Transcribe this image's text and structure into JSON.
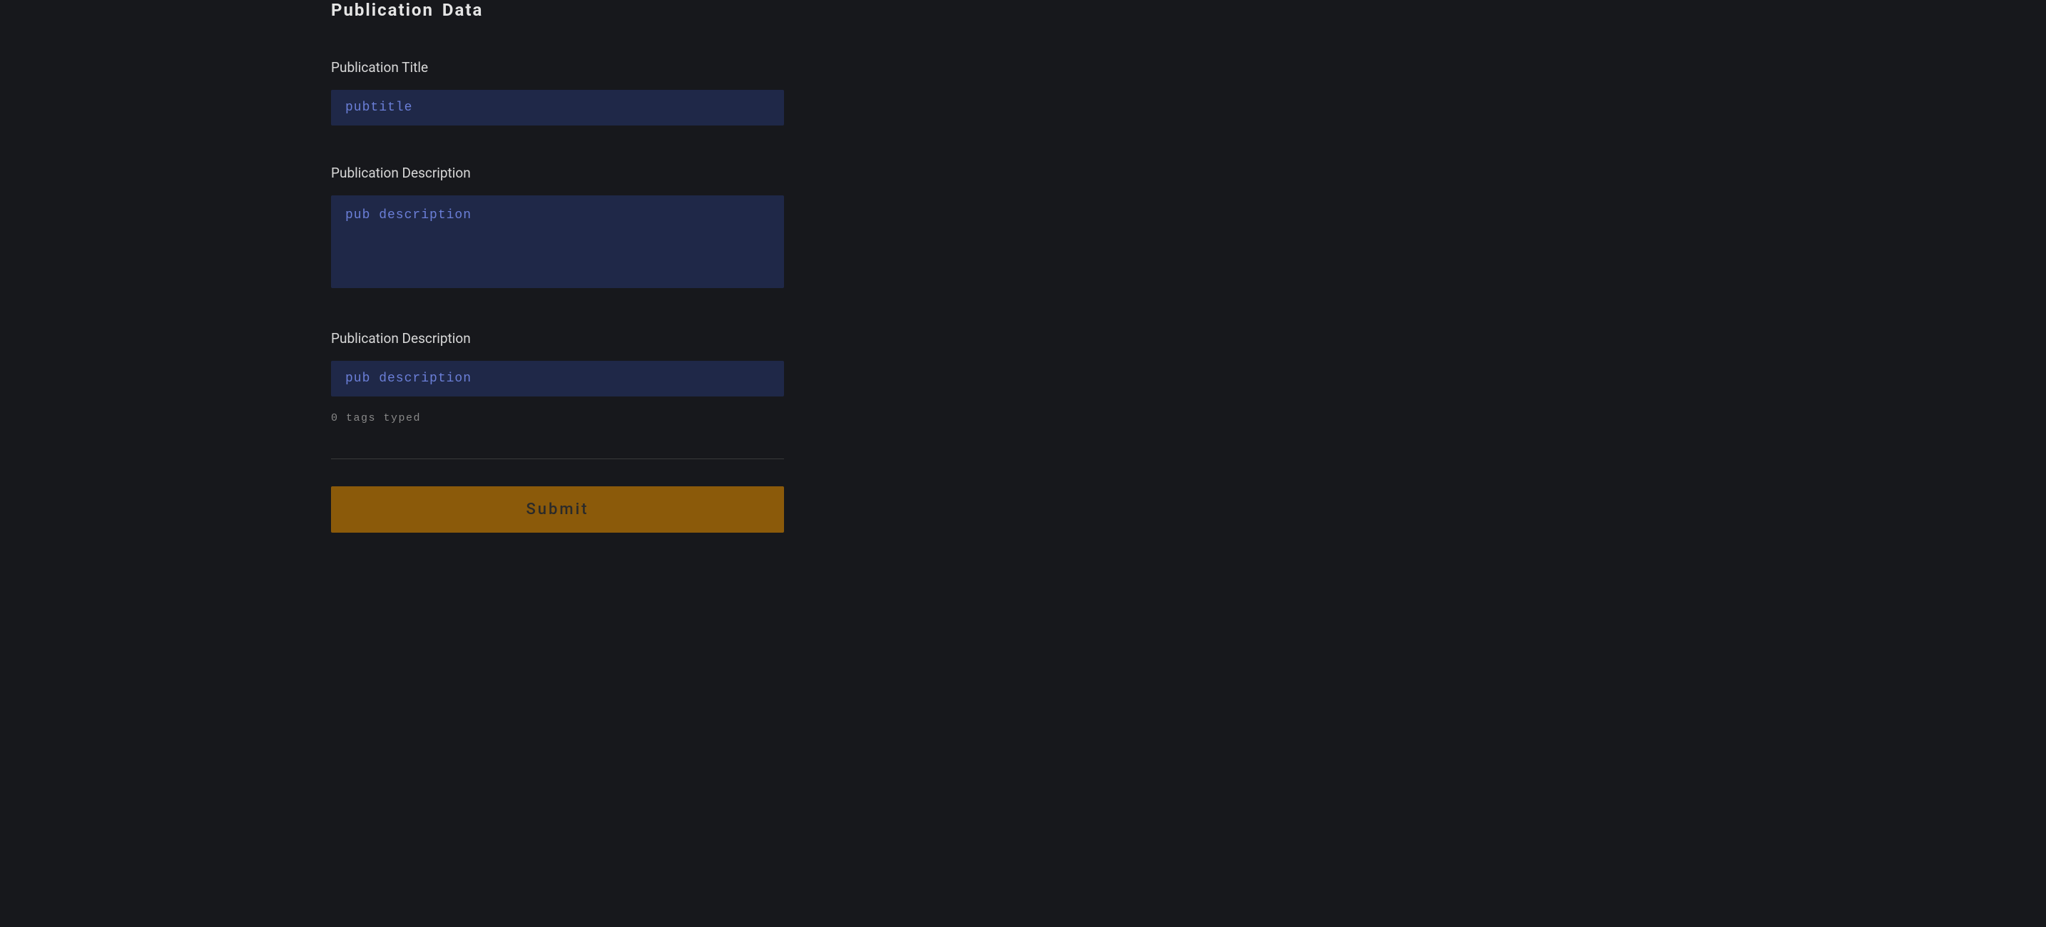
{
  "form": {
    "heading": "Publication Data",
    "title": {
      "label": "Publication Title",
      "placeholder": "pubtitle",
      "value": ""
    },
    "description": {
      "label": "Publication Description",
      "placeholder": "pub description",
      "value": ""
    },
    "tags": {
      "label": "Publication Description",
      "placeholder": "pub description",
      "value": "",
      "helper": "0 tags typed"
    },
    "submit": {
      "label": "Submit"
    }
  }
}
